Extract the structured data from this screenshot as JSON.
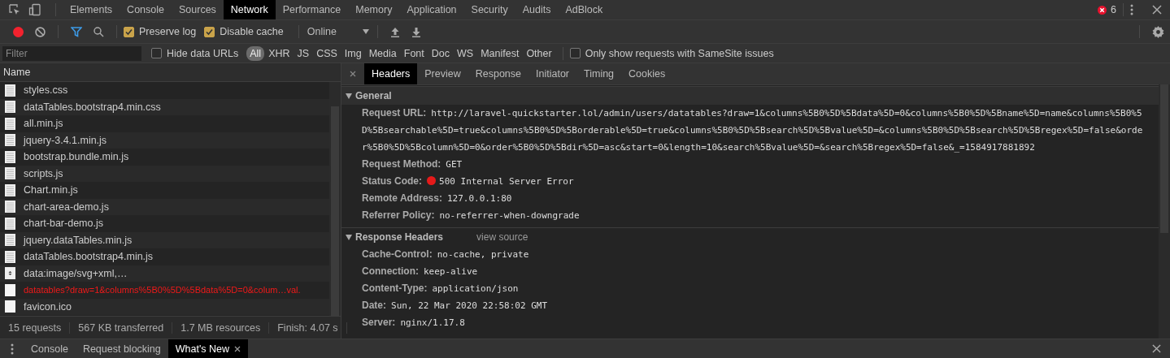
{
  "panel_tabs": [
    {
      "label": "Elements",
      "selected": false
    },
    {
      "label": "Console",
      "selected": false
    },
    {
      "label": "Sources",
      "selected": false
    },
    {
      "label": "Network",
      "selected": true
    },
    {
      "label": "Performance",
      "selected": false
    },
    {
      "label": "Memory",
      "selected": false
    },
    {
      "label": "Application",
      "selected": false
    },
    {
      "label": "Security",
      "selected": false
    },
    {
      "label": "Audits",
      "selected": false
    },
    {
      "label": "AdBlock",
      "selected": false
    }
  ],
  "error_count": "6",
  "toolbar": {
    "recording": true,
    "preserve_log": {
      "label": "Preserve log",
      "checked": true
    },
    "disable_cache": {
      "label": "Disable cache",
      "checked": true
    },
    "throttling": "Online"
  },
  "filter": {
    "placeholder": "Filter",
    "hide_data_urls": {
      "label": "Hide data URLs",
      "checked": false
    },
    "types": [
      {
        "label": "All",
        "selected": true
      },
      {
        "label": "XHR",
        "selected": false
      },
      {
        "label": "JS",
        "selected": false
      },
      {
        "label": "CSS",
        "selected": false
      },
      {
        "label": "Img",
        "selected": false
      },
      {
        "label": "Media",
        "selected": false
      },
      {
        "label": "Font",
        "selected": false
      },
      {
        "label": "Doc",
        "selected": false
      },
      {
        "label": "WS",
        "selected": false
      },
      {
        "label": "Manifest",
        "selected": false
      },
      {
        "label": "Other",
        "selected": false
      }
    ],
    "samesite": {
      "label": "Only show requests with SameSite issues",
      "checked": false
    }
  },
  "requests": {
    "column": "Name",
    "rows": [
      {
        "name": "styles.css",
        "kind": "file",
        "error": false
      },
      {
        "name": "dataTables.bootstrap4.min.css",
        "kind": "file",
        "error": false
      },
      {
        "name": "all.min.js",
        "kind": "file",
        "error": false
      },
      {
        "name": "jquery-3.4.1.min.js",
        "kind": "file",
        "error": false
      },
      {
        "name": "bootstrap.bundle.min.js",
        "kind": "file",
        "error": false
      },
      {
        "name": "scripts.js",
        "kind": "file",
        "error": false
      },
      {
        "name": "Chart.min.js",
        "kind": "file",
        "error": false
      },
      {
        "name": "chart-area-demo.js",
        "kind": "file",
        "error": false
      },
      {
        "name": "chart-bar-demo.js",
        "kind": "file",
        "error": false
      },
      {
        "name": "jquery.dataTables.min.js",
        "kind": "file",
        "error": false
      },
      {
        "name": "dataTables.bootstrap4.min.js",
        "kind": "file",
        "error": false
      },
      {
        "name": "data:image/svg+xml,…",
        "kind": "data",
        "error": false
      },
      {
        "name": "datatables?draw=1&columns%5B0%5D%5Bdata%5D=0&colum…val.",
        "kind": "blank",
        "error": true
      },
      {
        "name": "favicon.ico",
        "kind": "blank",
        "error": false
      }
    ]
  },
  "summary": [
    "15 requests",
    "567 KB transferred",
    "1.7 MB resources",
    "Finish: 4.07 s"
  ],
  "detail_tabs": [
    {
      "label": "Headers",
      "selected": true
    },
    {
      "label": "Preview",
      "selected": false
    },
    {
      "label": "Response",
      "selected": false
    },
    {
      "label": "Initiator",
      "selected": false
    },
    {
      "label": "Timing",
      "selected": false
    },
    {
      "label": "Cookies",
      "selected": false
    }
  ],
  "sections": [
    {
      "title": "General",
      "expanded": true,
      "rows": [
        {
          "label": "Request URL:",
          "value": "http://laravel-quickstarter.lol/admin/users/datatables?draw=1&columns%5B0%5D%5Bdata%5D=0&columns%5B0%5D%5Bname%5D=name&columns%5B0%5D%5Bsearchable%5D=true&columns%5B0%5D%5Borderable%5D=true&columns%5B0%5D%5Bsearch%5D%5Bvalue%5D=&columns%5B0%5D%5Bsearch%5D%5Bregex%5D=false&order%5B0%5D%5Bcolumn%5D=0&order%5B0%5D%5Bdir%5D=asc&start=0&length=10&search%5Bvalue%5D=&search%5Bregex%5D=false&_=1584917881892",
          "kind": "plain"
        },
        {
          "label": "Request Method:",
          "value": "GET",
          "kind": "plain"
        },
        {
          "label": "Status Code:",
          "value": "500 Internal Server Error",
          "kind": "status"
        },
        {
          "label": "Remote Address:",
          "value": "127.0.0.1:80",
          "kind": "plain"
        },
        {
          "label": "Referrer Policy:",
          "value": "no-referrer-when-downgrade",
          "kind": "plain"
        }
      ]
    },
    {
      "title": "Response Headers",
      "link": "view source",
      "expanded": true,
      "rows": [
        {
          "label": "Cache-Control:",
          "value": "no-cache, private",
          "kind": "plain"
        },
        {
          "label": "Connection:",
          "value": "keep-alive",
          "kind": "plain"
        },
        {
          "label": "Content-Type:",
          "value": "application/json",
          "kind": "plain"
        },
        {
          "label": "Date:",
          "value": "Sun, 22 Mar 2020 22:58:02 GMT",
          "kind": "plain"
        },
        {
          "label": "Server:",
          "value": "nginx/1.17.8",
          "kind": "plain"
        }
      ]
    }
  ],
  "drawer_tabs": [
    {
      "label": "Console",
      "selected": false
    },
    {
      "label": "Request blocking",
      "selected": false
    },
    {
      "label": "What's New",
      "selected": true
    }
  ]
}
